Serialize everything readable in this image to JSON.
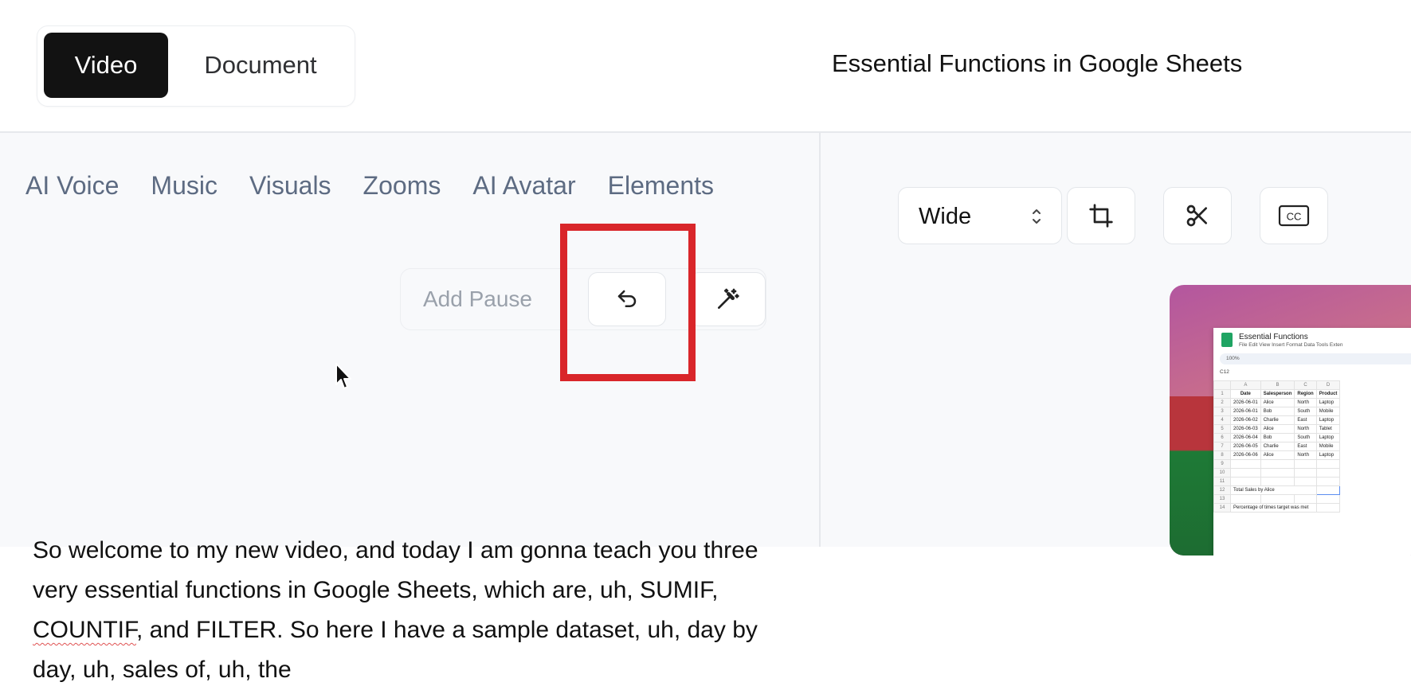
{
  "header": {
    "mode_tabs": [
      {
        "label": "Video",
        "active": true
      },
      {
        "label": "Document",
        "active": false
      }
    ],
    "title": "Essential Functions in Google Sheets"
  },
  "editor": {
    "tabs": [
      "AI Voice",
      "Music",
      "Visuals",
      "Zooms",
      "AI Avatar",
      "Elements"
    ],
    "toolbar": {
      "add_pause_label": "Add Pause",
      "undo_icon": "undo-icon",
      "magic_icon": "magic-wand-icon"
    },
    "transcript": {
      "part1": "So welcome to my new video, and today I am gonna teach you three very essential functions in Google Sheets, which are, uh, SUMIF, ",
      "misspelled": "COUNTIF",
      "part2": ", and FILTER. So here I have a sample dataset, uh, day by day, uh, sales of, uh, the"
    }
  },
  "preview_controls": {
    "aspect": "Wide",
    "crop_icon": "crop-icon",
    "cut_icon": "scissors-icon",
    "captions_label": "CC"
  },
  "preview": {
    "sheet_title": "Essential Functions",
    "menu": "File  Edit  View  Insert  Format  Data  Tools  Exten",
    "toolbar": "100%",
    "cell_ref": "C12",
    "columns": [
      "A",
      "B",
      "C",
      "D"
    ],
    "headers": [
      "Date",
      "Salesperson",
      "Region",
      "Product"
    ],
    "rows": [
      [
        "2026-06-01",
        "Alice",
        "North",
        "Laptop"
      ],
      [
        "2026-06-01",
        "Bob",
        "South",
        "Mobile"
      ],
      [
        "2026-06-02",
        "Charlie",
        "East",
        "Laptop"
      ],
      [
        "2026-06-03",
        "Alice",
        "North",
        "Tablet"
      ],
      [
        "2026-06-04",
        "Bob",
        "South",
        "Laptop"
      ],
      [
        "2026-06-05",
        "Charlie",
        "East",
        "Mobile"
      ],
      [
        "2026-06-06",
        "Alice",
        "North",
        "Laptop"
      ]
    ],
    "total_label": "Total Sales by Alice",
    "pct_label": "Percentage of times target was met"
  },
  "colors": {
    "highlight": "#d9262a",
    "active_tab_bg": "#121212",
    "tab_text": "#5d6b82"
  }
}
